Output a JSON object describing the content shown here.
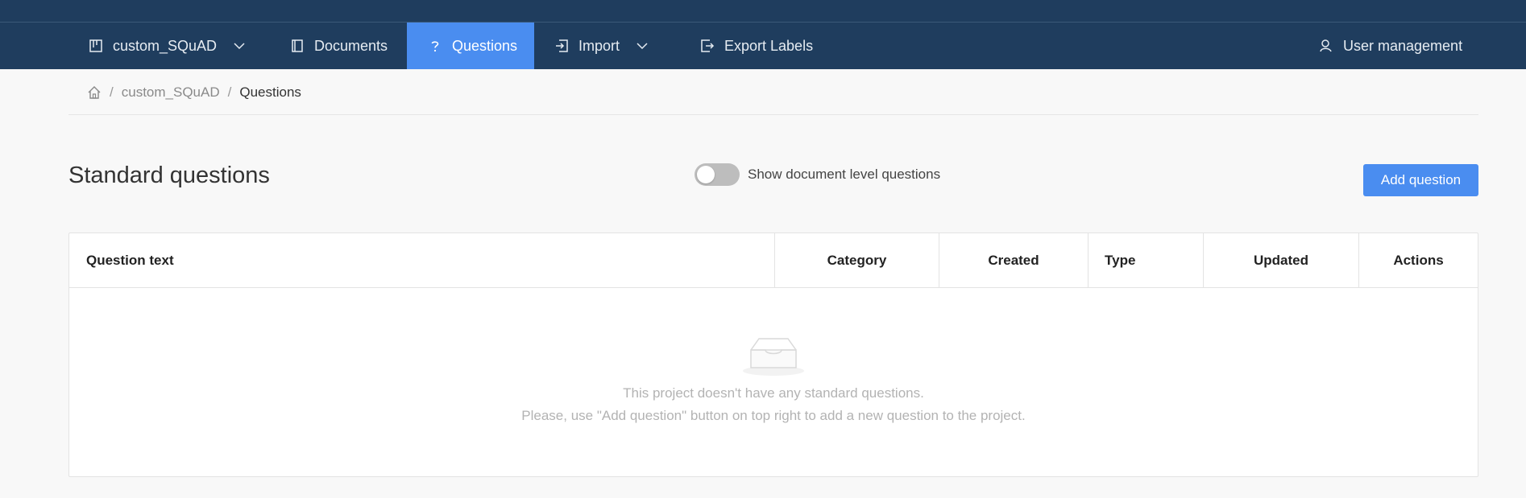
{
  "nav": {
    "project": "custom_SQuAD",
    "documents": "Documents",
    "questions": "Questions",
    "import": "Import",
    "export": "Export Labels",
    "user_management": "User management"
  },
  "breadcrumb": {
    "project": "custom_SQuAD",
    "separator": "/",
    "current": "Questions"
  },
  "page": {
    "title": "Standard questions",
    "toggle_label": "Show document level questions",
    "toggle_on": false,
    "add_button": "Add question"
  },
  "table": {
    "columns": [
      "Question text",
      "Category",
      "Created",
      "Type",
      "Updated",
      "Actions"
    ],
    "empty_line1": "This project doesn't have any standard questions.",
    "empty_line2": "Please, use \"Add question\" button on top right to add a new question to the project."
  },
  "colors": {
    "navbar": "#1f3d5e",
    "accent": "#4a8df0"
  }
}
